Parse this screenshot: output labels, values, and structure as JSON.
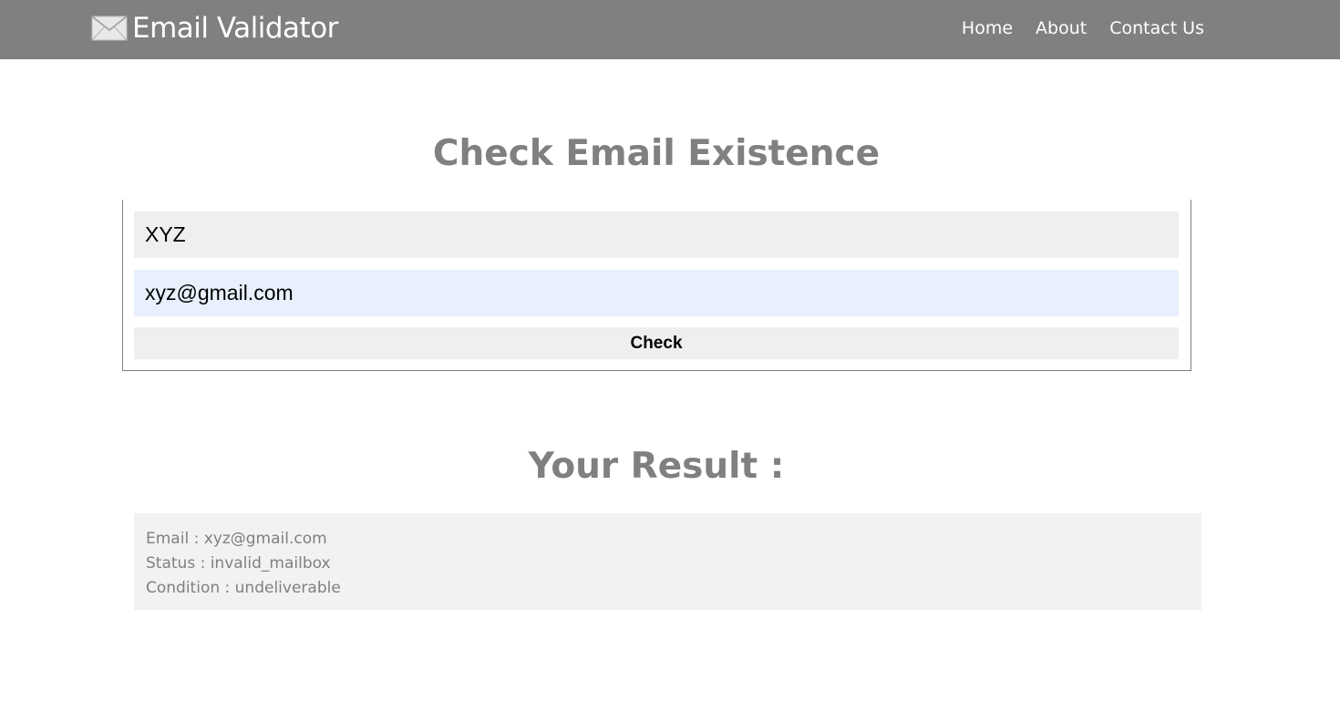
{
  "navbar": {
    "brand_title": "Email Validator",
    "brand_icon": "envelope-icon",
    "links": [
      {
        "label": "Home"
      },
      {
        "label": "About"
      },
      {
        "label": "Contact Us"
      }
    ],
    "background": "#808080"
  },
  "form": {
    "heading": "Check Email Existence",
    "name_value": "XYZ",
    "email_value": "xyz@gmail.com",
    "check_label": "Check"
  },
  "result": {
    "heading": "Your Result :",
    "email_line": "Email : xyz@gmail.com",
    "status_line": "Status : invalid_mailbox",
    "condition_line": "Condition : undeliverable"
  },
  "colors": {
    "heading_text": "#808080",
    "name_field_bg": "#f1eeee",
    "email_field_bg": "#e8f0fe",
    "button_bg": "#efefef",
    "result_bg": "#f3f1f2"
  }
}
